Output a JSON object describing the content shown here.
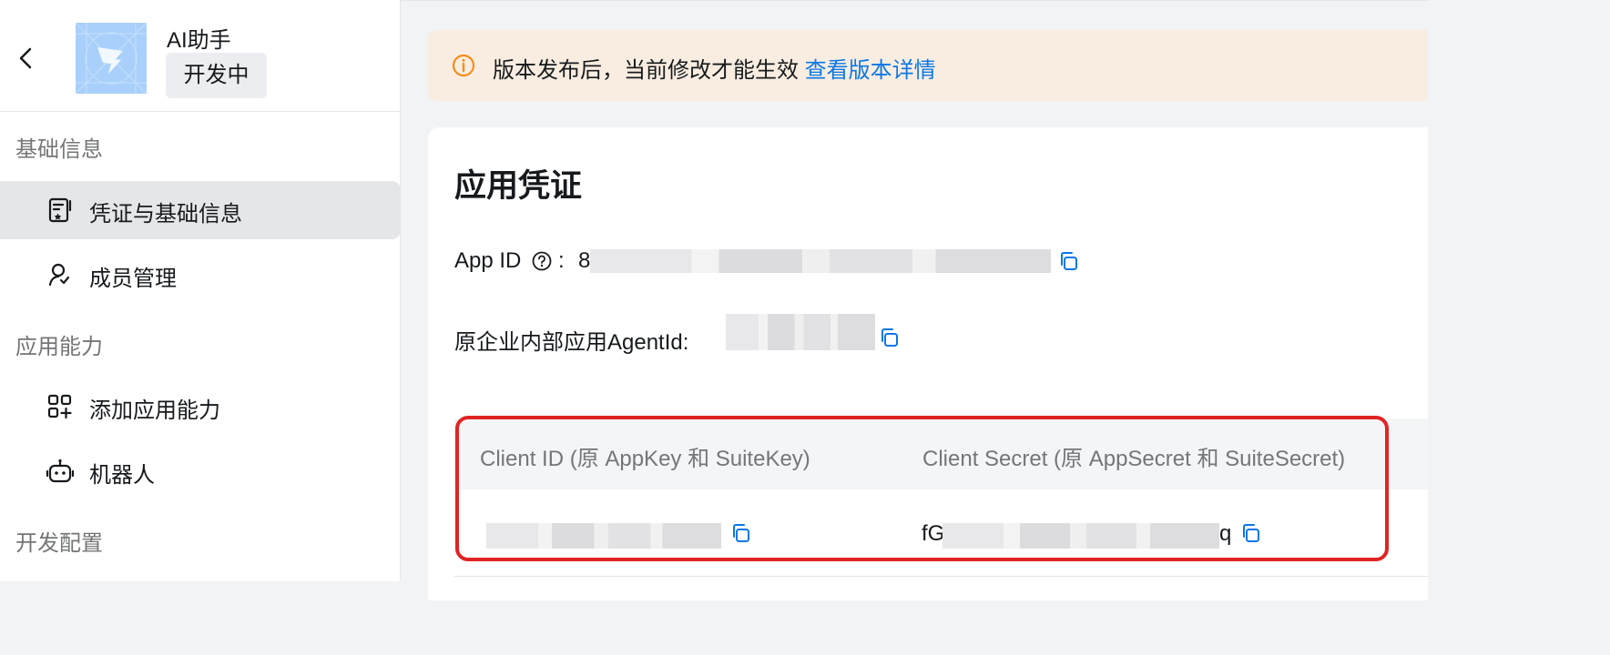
{
  "app": {
    "name": "AI助手",
    "status": "开发中"
  },
  "sidebar": {
    "groups": [
      {
        "label": "基础信息"
      },
      {
        "label": "应用能力"
      },
      {
        "label": "开发配置"
      }
    ],
    "items": [
      {
        "label": "凭证与基础信息",
        "active": true,
        "icon": "credential-icon"
      },
      {
        "label": "成员管理",
        "active": false,
        "icon": "member-icon"
      },
      {
        "label": "添加应用能力",
        "active": false,
        "icon": "add-capability-icon"
      },
      {
        "label": "机器人",
        "active": false,
        "icon": "robot-icon"
      }
    ]
  },
  "banner": {
    "text": "版本发布后，当前修改才能生效",
    "link": "查看版本详情"
  },
  "credentials": {
    "title": "应用凭证",
    "app_id_label": "App ID",
    "app_id_colon": ":",
    "app_id_prefix": "8",
    "agent_id_label": "原企业内部应用AgentId:",
    "client_id_header": "Client ID (原 AppKey 和 SuiteKey)",
    "client_secret_header": "Client Secret (原 AppSecret 和 SuiteSecret)",
    "client_secret_prefix": "fG",
    "client_secret_suffix": "q"
  },
  "colors": {
    "accent": "#0a77e6",
    "warning": "#f58d1c",
    "highlight": "#e02424",
    "banner_bg": "#f9ede1"
  }
}
